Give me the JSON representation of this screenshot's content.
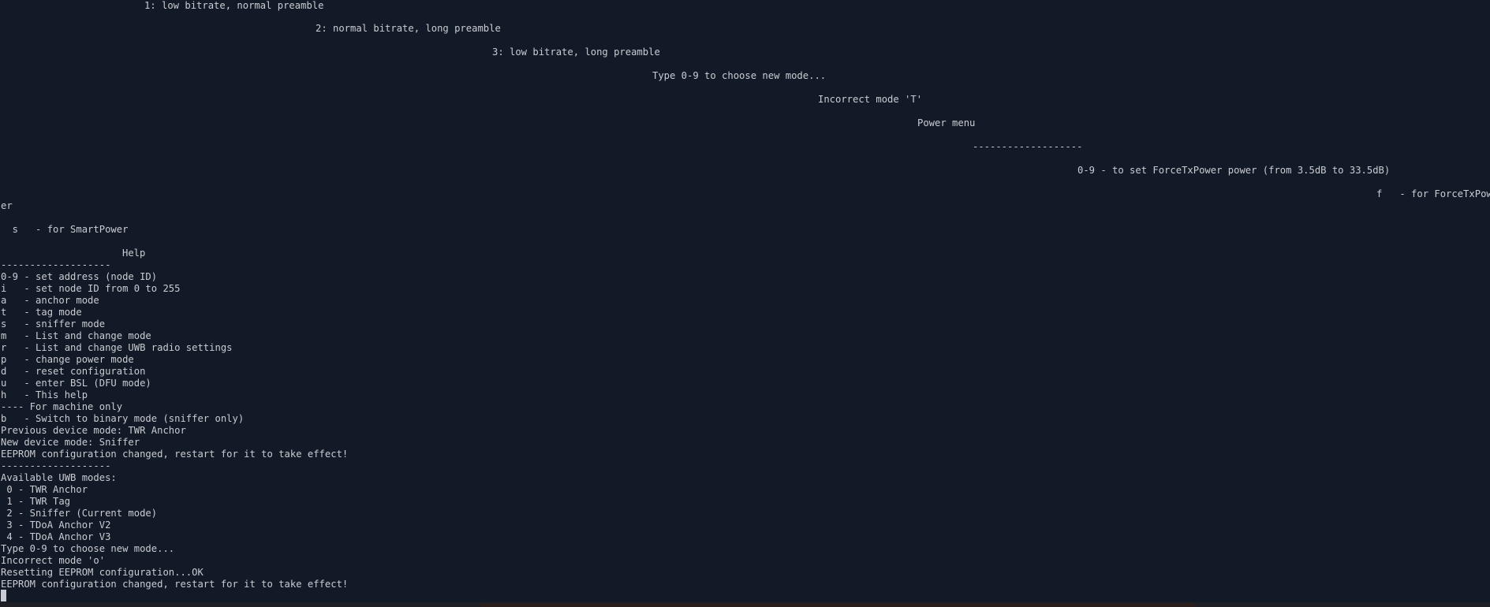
{
  "terminal": {
    "staircase_lines": [
      "1: low bitrate, normal preamble",
      "2: normal bitrate, long preamble",
      "3: low bitrate, long preamble",
      "Type 0-9 to choose new mode...",
      "Incorrect mode 'T'",
      "Power menu",
      "-------------------",
      "0-9 - to set ForceTxPower power (from 3.5dB to 33.5dB)",
      "f   - for ForceTxPow",
      "er",
      "  s   - for SmartPower",
      "Help"
    ],
    "log_lines": [
      "-------------------",
      "0-9 - set address (node ID)",
      "i   - set node ID from 0 to 255",
      "a   - anchor mode",
      "t   - tag mode",
      "s   - sniffer mode",
      "m   - List and change mode",
      "r   - List and change UWB radio settings",
      "p   - change power mode",
      "d   - reset configuration",
      "u   - enter BSL (DFU mode)",
      "h   - This help",
      "---- For machine only",
      "b   - Switch to binary mode (sniffer only)",
      "Previous device mode: TWR Anchor",
      "New device mode: Sniffer",
      "EEPROM configuration changed, restart for it to take effect!",
      "-------------------",
      "Available UWB modes:",
      " 0 - TWR Anchor",
      " 1 - TWR Tag",
      " 2 - Sniffer (Current mode)",
      " 3 - TDoA Anchor V2",
      " 4 - TDoA Anchor V3",
      "Type 0-9 to choose new mode...",
      "Incorrect mode 'o'",
      "Resetting EEPROM configuration...OK",
      "EEPROM configuration changed, restart for it to take effect!"
    ]
  },
  "colors": {
    "background": "#131a27",
    "text": "#c9ccd2"
  }
}
